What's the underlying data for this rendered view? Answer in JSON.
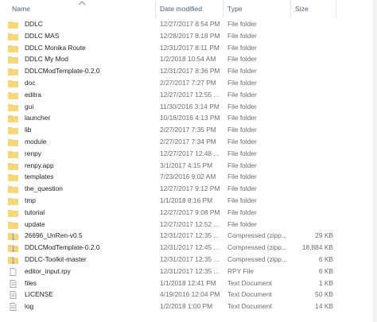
{
  "columns": {
    "name": "Name",
    "date": "Date modified",
    "type": "Type",
    "size": "Size"
  },
  "files": [
    {
      "name": "DDLC",
      "date": "12/27/2017 8:54 PM",
      "type": "File folder",
      "size": "",
      "icon": "folder-icon"
    },
    {
      "name": "DDLC MAS",
      "date": "12/28/2017 8:18 PM",
      "type": "File folder",
      "size": "",
      "icon": "folder-icon"
    },
    {
      "name": "DDLC Monika Route",
      "date": "12/31/2017 8:11 PM",
      "type": "File folder",
      "size": "",
      "icon": "folder-icon"
    },
    {
      "name": "DDLC My Mod",
      "date": "1/2/2018 10:54 AM",
      "type": "File folder",
      "size": "",
      "icon": "folder-icon"
    },
    {
      "name": "DDLCModTemplate-0.2.0",
      "date": "12/31/2017 8:36 PM",
      "type": "File folder",
      "size": "",
      "icon": "folder-icon"
    },
    {
      "name": "doc",
      "date": "2/27/2017 7:27 PM",
      "type": "File folder",
      "size": "",
      "icon": "folder-icon"
    },
    {
      "name": "editra",
      "date": "12/27/2017 12:55 ...",
      "type": "File folder",
      "size": "",
      "icon": "folder-icon"
    },
    {
      "name": "gui",
      "date": "11/30/2016 3:14 PM",
      "type": "File folder",
      "size": "",
      "icon": "folder-icon"
    },
    {
      "name": "launcher",
      "date": "10/18/2016 4:13 PM",
      "type": "File folder",
      "size": "",
      "icon": "folder-icon"
    },
    {
      "name": "lib",
      "date": "2/27/2017 7:35 PM",
      "type": "File folder",
      "size": "",
      "icon": "folder-icon"
    },
    {
      "name": "module",
      "date": "2/27/2017 7:34 PM",
      "type": "File folder",
      "size": "",
      "icon": "folder-icon"
    },
    {
      "name": "renpy",
      "date": "12/27/2017 12:48 ...",
      "type": "File folder",
      "size": "",
      "icon": "folder-icon"
    },
    {
      "name": "renpy.app",
      "date": "3/1/2017 4:15 PM",
      "type": "File folder",
      "size": "",
      "icon": "folder-icon"
    },
    {
      "name": "templates",
      "date": "7/23/2016 9:02 AM",
      "type": "File folder",
      "size": "",
      "icon": "folder-icon"
    },
    {
      "name": "the_question",
      "date": "12/27/2017 9:12 PM",
      "type": "File folder",
      "size": "",
      "icon": "folder-icon"
    },
    {
      "name": "tmp",
      "date": "1/1/2018 8:16 PM",
      "type": "File folder",
      "size": "",
      "icon": "folder-icon"
    },
    {
      "name": "tutorial",
      "date": "12/27/2017 9:08 PM",
      "type": "File folder",
      "size": "",
      "icon": "folder-icon"
    },
    {
      "name": "update",
      "date": "12/27/2017 12:52 ...",
      "type": "File folder",
      "size": "",
      "icon": "folder-icon"
    },
    {
      "name": "26696_UnRen-v0.5",
      "date": "12/31/2017 12:35 ...",
      "type": "Compressed (zipp...",
      "size": "29 KB",
      "icon": "zip-folder-icon"
    },
    {
      "name": "DDLCModTemplate-0.2.0",
      "date": "12/31/2017 12:45 ...",
      "type": "Compressed (zipp...",
      "size": "18,884 KB",
      "icon": "zip-folder-icon"
    },
    {
      "name": "DDLC-Toolkit-master",
      "date": "12/31/2017 12:35 ...",
      "type": "Compressed (zipp...",
      "size": "6 KB",
      "icon": "zip-folder-icon"
    },
    {
      "name": "editor_input.rpy",
      "date": "12/31/2017 12:35 ...",
      "type": "RPY File",
      "size": "6 KB",
      "icon": "file-icon"
    },
    {
      "name": "files",
      "date": "1/1/2018 12:41 PM",
      "type": "Text Document",
      "size": "1 KB",
      "icon": "text-file-icon"
    },
    {
      "name": "LICENSE",
      "date": "4/19/2016 12:04 PM",
      "type": "Text Document",
      "size": "50 KB",
      "icon": "text-file-icon"
    },
    {
      "name": "log",
      "date": "1/2/2018 1:00 PM",
      "type": "Text Document",
      "size": "14 KB",
      "icon": "text-file-icon"
    }
  ],
  "colors": {
    "header_text": "#4c607a",
    "folder": "#f8d775",
    "folder_dark": "#e6b84a",
    "zip_stripe": "#8a8a8a"
  }
}
